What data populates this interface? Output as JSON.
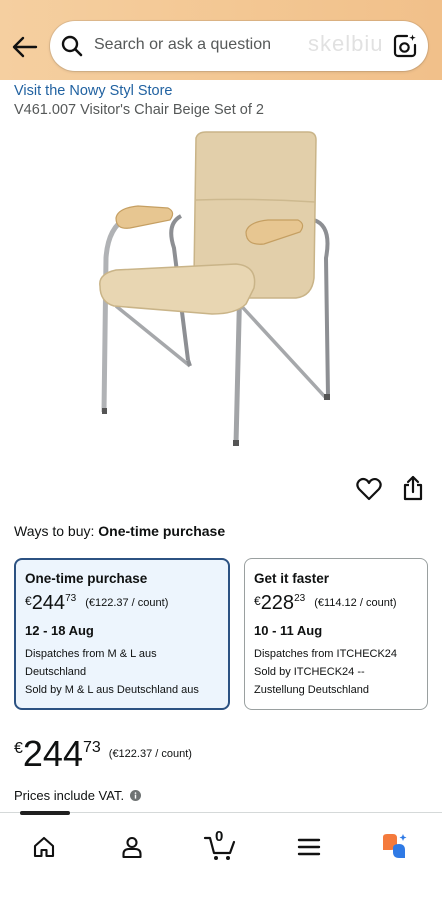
{
  "header": {
    "search_placeholder": "Search or ask a question",
    "watermark": "skelbiu"
  },
  "product": {
    "store_link": "Visit the Nowy Styl Store",
    "title": "V461.007 Visitor's Chair Beige Set of 2"
  },
  "buying": {
    "ways_label": "Ways to buy:",
    "ways_value": "One-time purchase"
  },
  "offers": [
    {
      "title": "One-time purchase",
      "currency": "€",
      "price_whole": "244",
      "price_fraction": "73",
      "unit_price": "(€122.37 / count)",
      "delivery": "12 - 18 Aug",
      "dispatch": "Dispatches from M & L aus Deutschland",
      "sold_by": "Sold by M & L aus Deutschland aus"
    },
    {
      "title": "Get it faster",
      "currency": "€",
      "price_whole": "228",
      "price_fraction": "23",
      "unit_price": "(€114.12 / count)",
      "delivery": "10 - 11 Aug",
      "dispatch": "Dispatches from ITCHECK24",
      "sold_by": "Sold by ITCHECK24 -- Zustellung Deutschland"
    }
  ],
  "main_price": {
    "currency": "€",
    "whole": "244",
    "fraction": "73",
    "unit_price": "(€122.37 / count)"
  },
  "vat_note": "Prices include VAT.",
  "nav": {
    "cart_count": "0",
    "items": [
      "home-icon",
      "account-icon",
      "cart-icon",
      "menu-icon",
      "ai-assistant-icon"
    ]
  },
  "colors": {
    "link": "#2162a1",
    "selected_border": "#2c5282",
    "selected_bg": "#edf5fd",
    "header_bg": "#f3c793"
  }
}
